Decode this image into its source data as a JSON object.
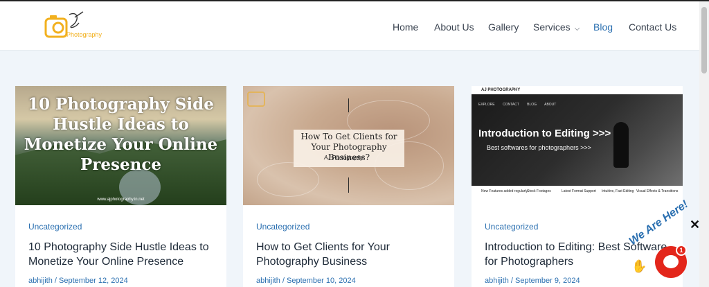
{
  "logo": {
    "brand": "Photography"
  },
  "nav": {
    "items": [
      {
        "label": "Home"
      },
      {
        "label": "About Us"
      },
      {
        "label": "Gallery"
      },
      {
        "label": "Services"
      },
      {
        "label": "Blog"
      },
      {
        "label": "Contact Us"
      }
    ]
  },
  "posts": [
    {
      "image_text": "10 Photography Side Hustle Ideas to Monetize Your Online Presence",
      "image_url": "www.ajphotography.in.net",
      "category": "Uncategorized",
      "title": "10 Photography Side Hustle Ideas to Monetize Your Online Presence",
      "meta": "abhijith / September 12, 2024"
    },
    {
      "image_text": "How To Get Clients for Your Photography Business?",
      "image_sub": "AJ Photography",
      "category": "Uncategorized",
      "title": "How to Get Clients for Your Photography Business",
      "meta": "abhijith / September 10, 2024"
    },
    {
      "image_brand": "AJ PHOTOGRAPHY",
      "image_nav": "EXPLORE CONTACT BLOG ABOUT",
      "image_heading": "Introduction to Editing >>>",
      "image_sub": "Best softwares for photographers >>>",
      "image_icons": [
        "New Features added regularly",
        "Stock Footages",
        "Latest Format Support",
        "Intuitive, Fast Editing",
        "Visual Effects & Transitions"
      ],
      "category": "Uncategorized",
      "title": "Introduction to Editing: Best Software for Photographers",
      "meta": "abhijith / September 9, 2024"
    }
  ],
  "chat": {
    "badge": "1",
    "tagline": "We Are Here!",
    "close": "✕"
  },
  "colors": {
    "accent": "#2a6fb0",
    "chat_red": "#e3261b",
    "logo_gold": "#f2b01e"
  }
}
